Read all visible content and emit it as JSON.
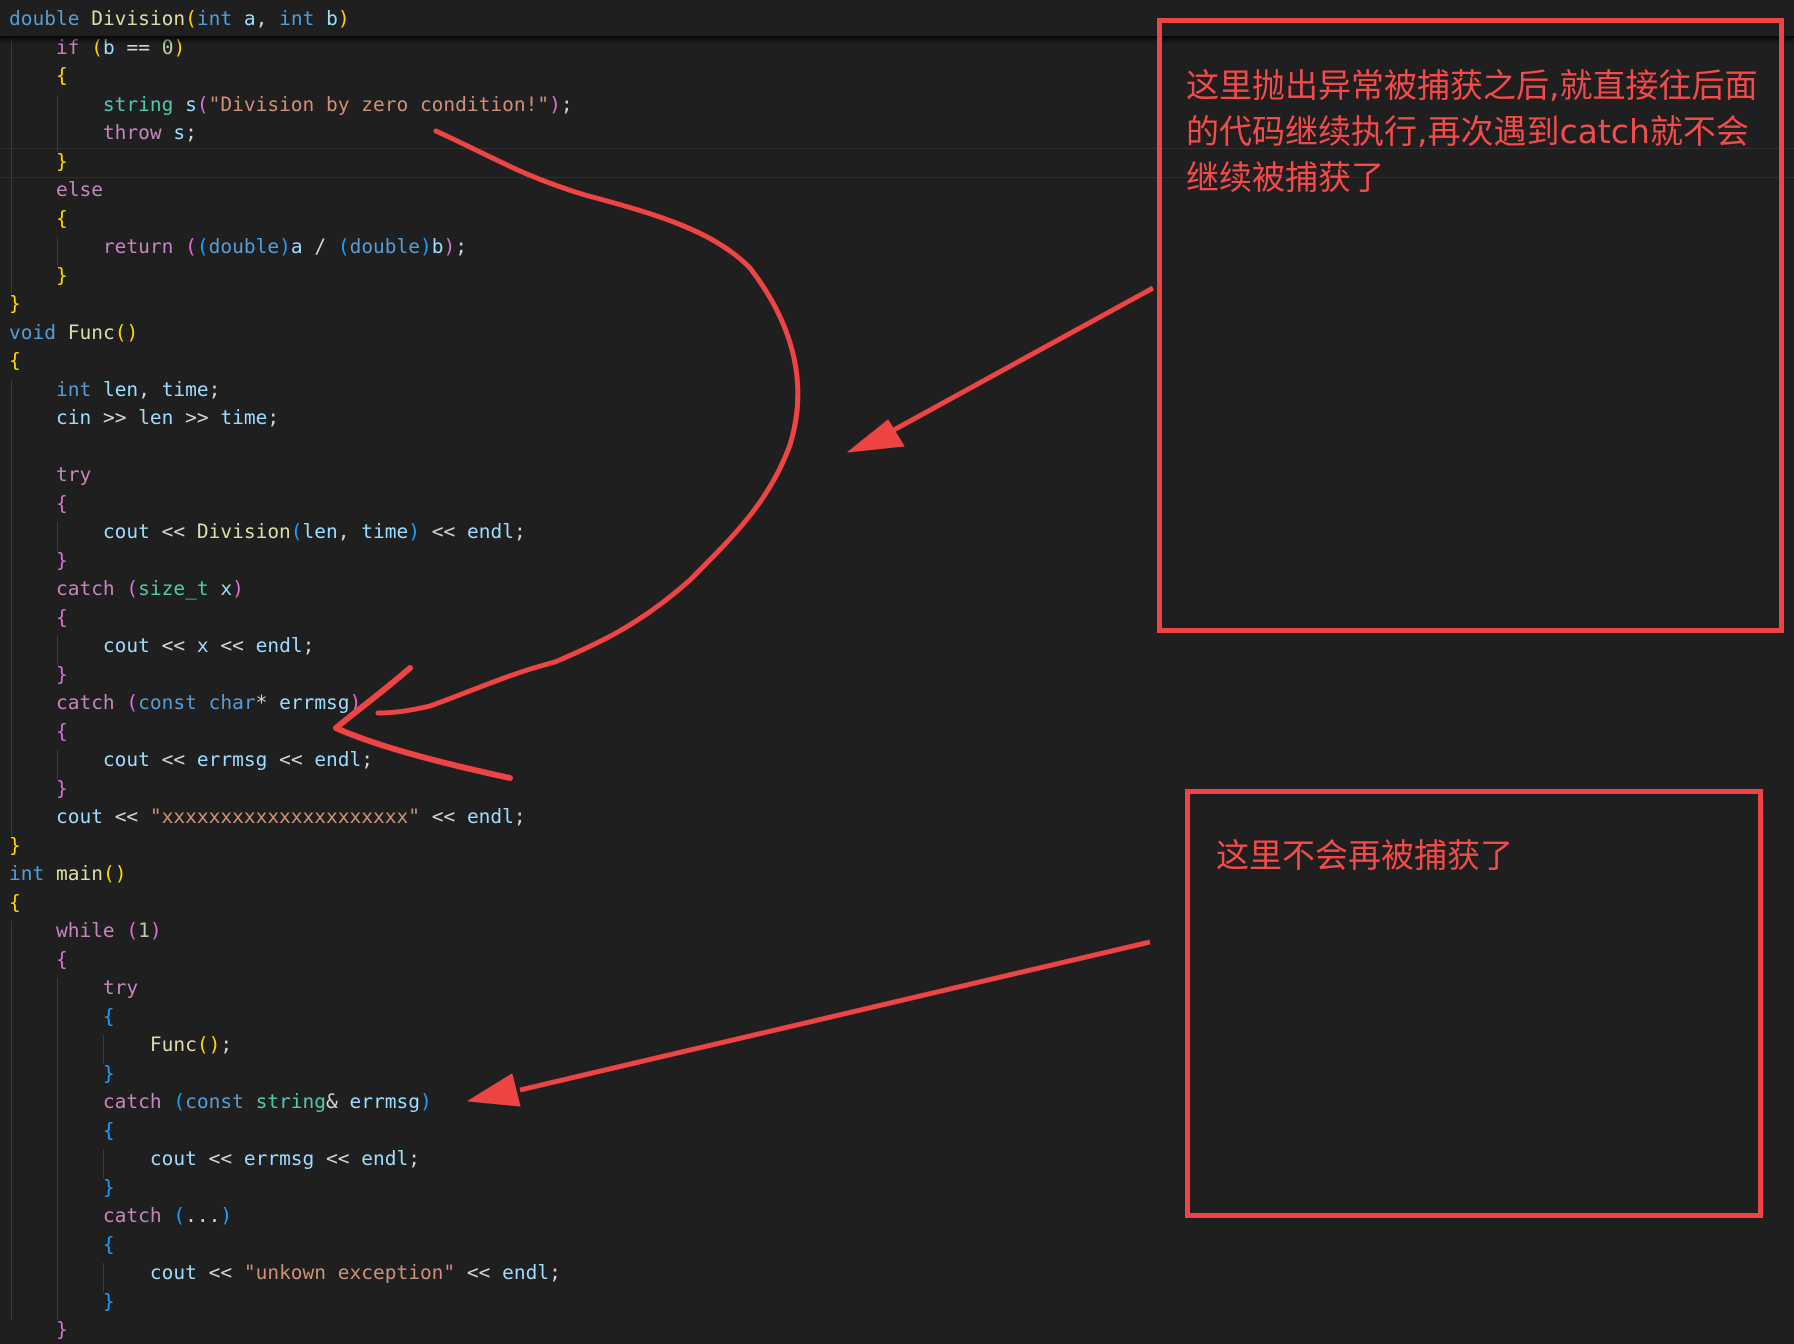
{
  "colors": {
    "background": "#1f1f1f",
    "keyword": "#569cd6",
    "control": "#c586c0",
    "function": "#dcdcaa",
    "variable": "#9cdcfe",
    "type": "#4ec9b0",
    "string": "#ce9178",
    "number": "#b5cea8",
    "annotation": "#ef4444"
  },
  "code_lines": [
    "double Division(int a, int b)",
    "    if (b == 0)",
    "    {",
    "        string s(\"Division by zero condition!\");",
    "        throw s;",
    "    }",
    "    else",
    "    {",
    "        return ((double)a / (double)b);",
    "    }",
    "}",
    "void Func()",
    "{",
    "    int len, time;",
    "    cin >> len >> time;",
    "",
    "    try",
    "    {",
    "        cout << Division(len, time) << endl;",
    "    }",
    "    catch (size_t x)",
    "    {",
    "        cout << x << endl;",
    "    }",
    "    catch (const char* errmsg)",
    "    {",
    "        cout << errmsg << endl;",
    "    }",
    "    cout << \"xxxxxxxxxxxxxxxxxxxxx\" << endl;",
    "}",
    "int main()",
    "{",
    "    while (1)",
    "    {",
    "        try",
    "        {",
    "            Func();",
    "        }",
    "        catch (const string& errmsg)",
    "        {",
    "            cout << errmsg << endl;",
    "        }",
    "        catch (...)",
    "        {",
    "            cout << \"unkown exception\" << endl;",
    "        }",
    "    }"
  ],
  "annotations": {
    "note_top": "这里抛出异常被捕获之后,就直接往后面的代码继续执行,再次遇到catch就不会继续被捕获了",
    "note_bottom": "这里不会再被捕获了"
  }
}
